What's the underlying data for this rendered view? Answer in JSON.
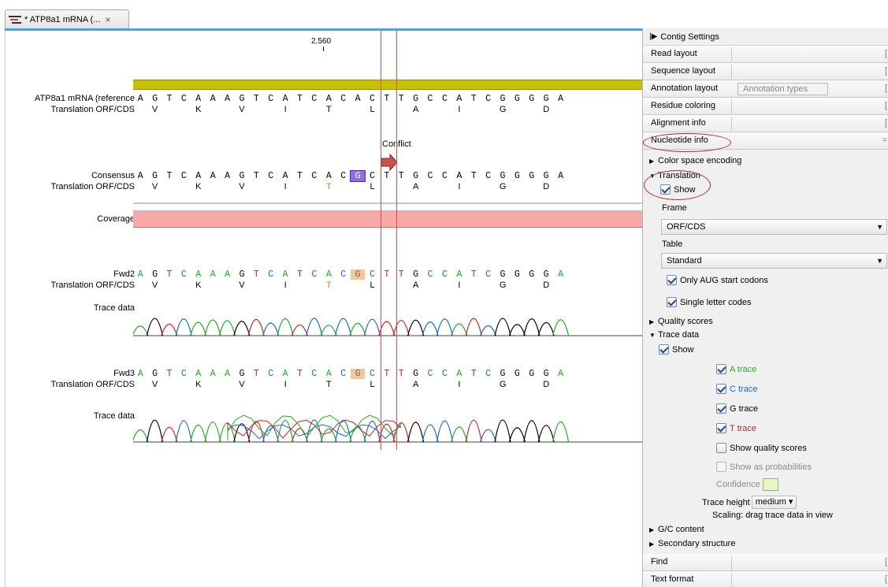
{
  "tab": {
    "title": "* ATP8a1 mRNA (...",
    "close": "×"
  },
  "view": {
    "ruler_position": "2,560",
    "rows": {
      "reference_label": "ATP8a1 mRNA (reference",
      "translation_label": "Translation ORF/CDS",
      "consensus_label": "Consensus",
      "coverage_label": "Coverage",
      "fwd2_label": "Fwd2",
      "fwd3_label": "Fwd3",
      "trace_label": "Trace data"
    },
    "bases": [
      "A",
      "G",
      "T",
      "C",
      "A",
      "A",
      "A",
      "G",
      "T",
      "C",
      "A",
      "T",
      "C",
      "A",
      "C",
      "A",
      "C",
      "T",
      "T",
      "G",
      "C",
      "C",
      "A",
      "T",
      "C",
      "G",
      "G",
      "G",
      "G",
      "A"
    ],
    "conflict_base": "G",
    "amino_acids": [
      "V",
      "K",
      "V",
      "I",
      "T",
      "L",
      "A",
      "I",
      "G",
      "D"
    ],
    "conflict_label": "Conflict"
  },
  "panel": {
    "title": "Contig Settings",
    "sections": {
      "read_layout": "Read layout",
      "sequence_layout": "Sequence layout",
      "annotation_layout": "Annotation layout",
      "annotation_types": "Annotation types",
      "residue_coloring": "Residue coloring",
      "alignment_info": "Alignment info",
      "nucleotide_info": "Nucleotide info",
      "find": "Find",
      "text_format": "Text format"
    },
    "items": {
      "color_space": "Color space encoding",
      "translation": "Translation",
      "show": "Show",
      "frame": "Frame",
      "frame_value": "ORF/CDS",
      "table": "Table",
      "table_value": "Standard",
      "only_aug": "Only AUG start codons",
      "single_letter": "Single letter codes",
      "quality_scores": "Quality scores",
      "trace_data": "Trace data",
      "trace_show": "Show",
      "a_trace": "A trace",
      "c_trace": "C trace",
      "g_trace": "G trace",
      "t_trace": "T trace",
      "show_quality": "Show quality scores",
      "show_prob": "Show as probabilities",
      "confidence": "Confidence",
      "trace_height": "Trace height",
      "trace_height_value": "medium",
      "scaling": "Scaling: drag trace data in view",
      "gc_content": "G/C content",
      "secondary_structure": "Secondary structure"
    }
  },
  "colors": {
    "a_trace": "#22aa22",
    "c_trace": "#1a66cc",
    "g_trace": "#000000",
    "t_trace": "#cc2222",
    "highlight": "#b0272a"
  }
}
